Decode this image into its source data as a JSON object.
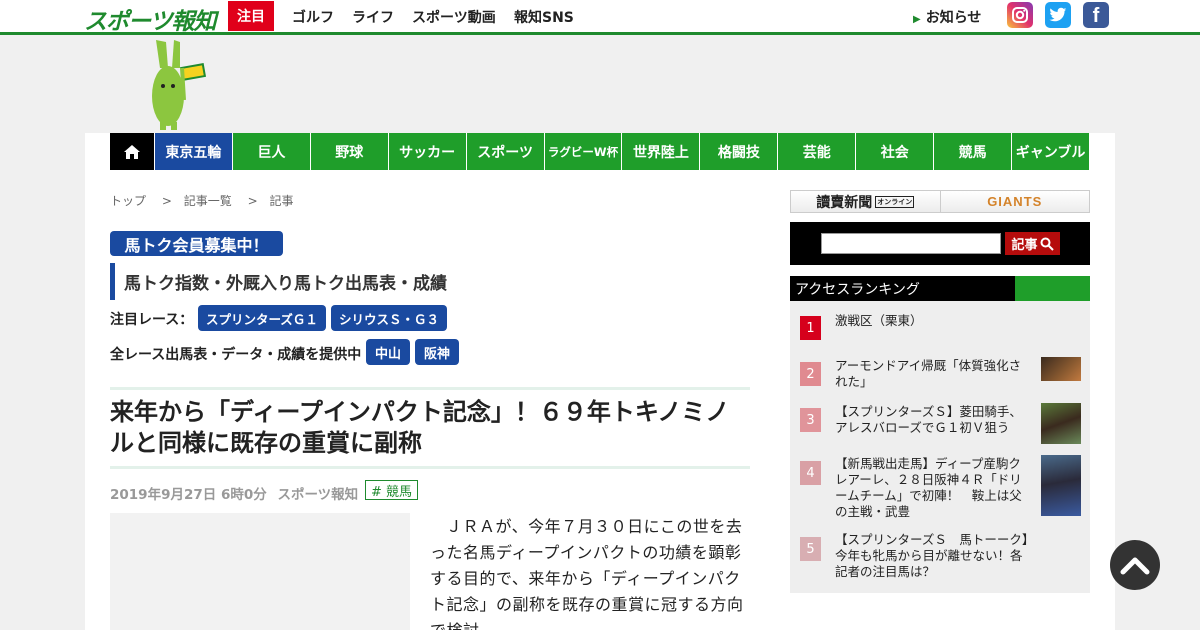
{
  "header": {
    "logo": "スポーツ報知",
    "hot_label": "注目",
    "nav": [
      "ゴルフ",
      "ライフ",
      "スポーツ動画",
      "報知SNS"
    ],
    "news_label": "お知らせ"
  },
  "global_nav": {
    "items": [
      "東京五輪",
      "巨人",
      "野球",
      "サッカー",
      "スポーツ",
      "ラグビーW杯",
      "世界陸上",
      "格闘技",
      "芸能",
      "社会",
      "競馬",
      "ギャンブル"
    ],
    "selected": "東京五輪"
  },
  "breadcrumb": [
    "トップ",
    ">",
    "記事一覧",
    ">",
    "記事"
  ],
  "promo": {
    "badge": "馬トク会員募集中！",
    "subtitle": "馬トク指数・外厩入り馬トク出馬表・成績",
    "featured_label": "注目レース：",
    "featured_races": [
      "スプリンターズＧ１",
      "シリウスＳ・Ｇ３"
    ],
    "all_label": "全レース出馬表・データ・成績を提供中",
    "venues": [
      "中山",
      "阪神"
    ]
  },
  "article": {
    "title": "来年から「ディープインパクト記念」！６９年トキノミノルと同様に既存の重賞に副称",
    "date": "2019年9月27日 6時0分",
    "source": "スポーツ報知",
    "tag": "# 競馬",
    "body": "ＪＲＡが、今年７月３０日にこの世を去った名馬ディープインパクトの功績を顕彰する目的で、来年から「ディープインパクト記念」の副称を既存の重賞に冠する方向で検討"
  },
  "sidebar": {
    "banner_left": "讀賣新聞",
    "banner_left_small": "オンライン",
    "banner_right": "GIANTS",
    "search_button": "記事",
    "ranking_title": "アクセスランキング",
    "ranking": [
      {
        "rank": "1",
        "text": "激戦区（栗東）",
        "color": "#d6001c"
      },
      {
        "rank": "2",
        "text": "アーモンドアイ帰厩「体質強化された」",
        "color": "#e08a90"
      },
      {
        "rank": "3",
        "text": "【スプリンターズＳ】菱田騎手、アレスバローズでＧ１初Ｖ狙う",
        "color": "#e0949a"
      },
      {
        "rank": "4",
        "text": "【新馬戦出走馬】ディープ産駒クレアーレ、２８日阪神４Ｒ「ドリームチーム」で初陣！　鞍上は父の主戦・武豊",
        "color": "#d9a0a5"
      },
      {
        "rank": "5",
        "text": "【スプリンターズＳ　馬トーーク】今年も牝馬から目が離せない！各記者の注目馬は？",
        "color": "#d8aeb2"
      }
    ]
  },
  "colors": {
    "brand_green": "#1f8a2e",
    "nav_green": "#1f9e2a",
    "accent_blue": "#1a4aa0",
    "hot_red": "#e0001a"
  }
}
